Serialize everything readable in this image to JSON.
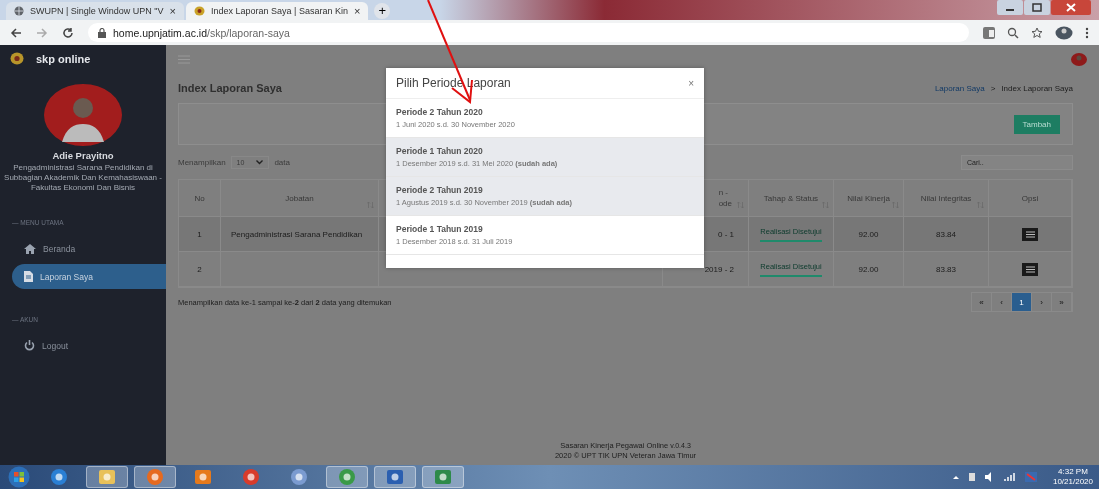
{
  "browser": {
    "tabs": [
      {
        "title": "SWUPN | Single Window UPN \"V",
        "close": "×",
        "selected": false
      },
      {
        "title": "Index Laporan Saya | Sasaran Kin",
        "close": "×",
        "selected": true
      }
    ],
    "new_tab": "+",
    "url_host": "home.upnjatim.ac.id",
    "url_path": "/skp/laporan-saya"
  },
  "sidebar": {
    "brand": "skp online",
    "user_name": "Adie Prayitno",
    "user_role": "Pengadministrasi Sarana Pendidikan di Subbagian Akademik Dan Kemahasiswaan - Fakultas Ekonomi Dan Bisnis",
    "sections": [
      {
        "heading": "— MENU UTAMA",
        "items": [
          {
            "label": "Beranda",
            "kind": "home",
            "selected": false
          },
          {
            "label": "Laporan Saya",
            "kind": "file",
            "selected": true
          }
        ]
      },
      {
        "heading": "— AKUN",
        "items": [
          {
            "label": "Logout",
            "kind": "power",
            "selected": false
          }
        ]
      }
    ]
  },
  "page": {
    "title": "Index Laporan Saya",
    "breadcrumb": [
      {
        "label": "Laporan Saya",
        "link": true
      },
      {
        "label": "Index Laporan Saya",
        "link": false
      }
    ],
    "breadcrumb_separator": ">",
    "add_button": "Tambah",
    "show_label": "Menampilkan",
    "page_size": "10",
    "show_suffix": "data",
    "search_placeholder": "Cari..",
    "table": {
      "columns": [
        {
          "label": "No",
          "sortable": false
        },
        {
          "label": "Jobatan",
          "sortable": true
        },
        {
          "label": "n -\node",
          "sortable": true
        },
        {
          "label": "Tahap & Status",
          "sortable": true
        },
        {
          "label": "Nilai Kinerja",
          "sortable": true
        },
        {
          "label": "Nilai Integritas",
          "sortable": true
        },
        {
          "label": "Opsi",
          "sortable": false
        }
      ],
      "rows": [
        {
          "no": "1",
          "jobatan": "Pengadministrasi Sarana Pendidikan",
          "periode": "0 - 1",
          "status": "Realisasi Disetujui",
          "level": 1,
          "kinerja": "92.00",
          "integritas": "83.84"
        },
        {
          "no": "2",
          "periode": "2019 - 2",
          "status": "Realisasi Disetujui",
          "level": 1,
          "kinerja": "92.00",
          "integritas": "83.83"
        }
      ]
    },
    "info": "Menampilkan data ke-1 sampai ke-**2** dari **2** data yang ditemukan",
    "pagination": [
      {
        "label": "«",
        "selected": false
      },
      {
        "label": "‹",
        "selected": false
      },
      {
        "label": "1",
        "selected": true
      },
      {
        "label": "›",
        "selected": false
      },
      {
        "label": "»",
        "selected": false
      }
    ],
    "footer_title": "Sasaran Kinerja Pegawai Online",
    "footer_version": "v.0.4.3",
    "footer_copyright": "2020 © UPT TIK UPN Veteran Jawa Timur"
  },
  "modal": {
    "title": "Pilih Periode Laporan",
    "close": "×",
    "options": [
      {
        "title": "Periode 2 Tahun 2020",
        "range": "1 Juni 2020 s.d. 30 November 2020",
        "disabled": false
      },
      {
        "title": "Periode 1 Tahun 2020",
        "range": "1 Desember 2019 s.d. 31 Mei 2020 **(sudah ada)**",
        "disabled": true
      },
      {
        "title": "Periode 2 Tahun 2019",
        "range": "1 Agustus 2019 s.d. 30 November 2019 **(sudah ada)**",
        "disabled": true
      },
      {
        "title": "Periode 1 Tahun 2019",
        "range": "1 Desember 2018 s.d. 31 Juli 2019",
        "disabled": false
      }
    ]
  },
  "taskbar": {
    "apps": [
      {
        "kind": "ie",
        "open": false
      },
      {
        "kind": "folder",
        "open": true
      },
      {
        "kind": "firefox",
        "open": true
      },
      {
        "kind": "media",
        "open": false
      },
      {
        "kind": "camera",
        "open": false
      },
      {
        "kind": "paint",
        "open": false
      },
      {
        "kind": "chrome",
        "open": true
      },
      {
        "kind": "word",
        "open": true
      },
      {
        "kind": "excel",
        "open": true
      }
    ],
    "time": "4:32 PM",
    "date": "10/21/2020"
  }
}
